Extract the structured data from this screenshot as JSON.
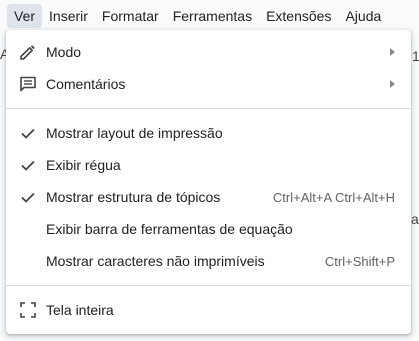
{
  "menubar": {
    "items": [
      "Ver",
      "Inserir",
      "Formatar",
      "Ferramentas",
      "Extensões",
      "Ajuda"
    ],
    "active_item": "Ver"
  },
  "background": {
    "left_fragment": "A",
    "right_fragment_top": "1",
    "right_fragment_mid": "ai"
  },
  "menu": {
    "modo": {
      "label": "Modo",
      "icon": "pencil-icon"
    },
    "comentarios": {
      "label": "Comentários",
      "icon": "comment-icon"
    },
    "layout": {
      "label": "Mostrar layout de impressão",
      "checked": true
    },
    "regua": {
      "label": "Exibir régua",
      "checked": true
    },
    "topicos": {
      "label": "Mostrar estrutura de tópicos",
      "checked": true,
      "shortcut": "Ctrl+Alt+A Ctrl+Alt+H"
    },
    "equacao": {
      "label": "Exibir barra de ferramentas de equação"
    },
    "caracteres": {
      "label": "Mostrar caracteres não imprimíveis",
      "shortcut": "Ctrl+Shift+P"
    },
    "tela": {
      "label": "Tela inteira",
      "icon": "fullscreen-icon"
    }
  }
}
